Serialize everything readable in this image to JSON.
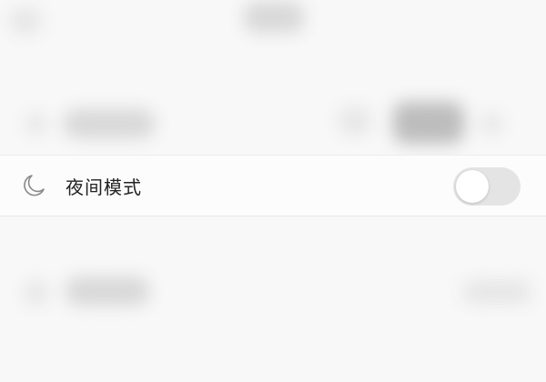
{
  "settings": {
    "night_mode": {
      "icon": "moon-icon",
      "label": "夜间模式",
      "enabled": false
    }
  },
  "colors": {
    "toggle_off_track": "#e4e4e4",
    "toggle_knob": "#ffffff",
    "label_text": "#222222",
    "icon_stroke": "#8a8a8a"
  }
}
